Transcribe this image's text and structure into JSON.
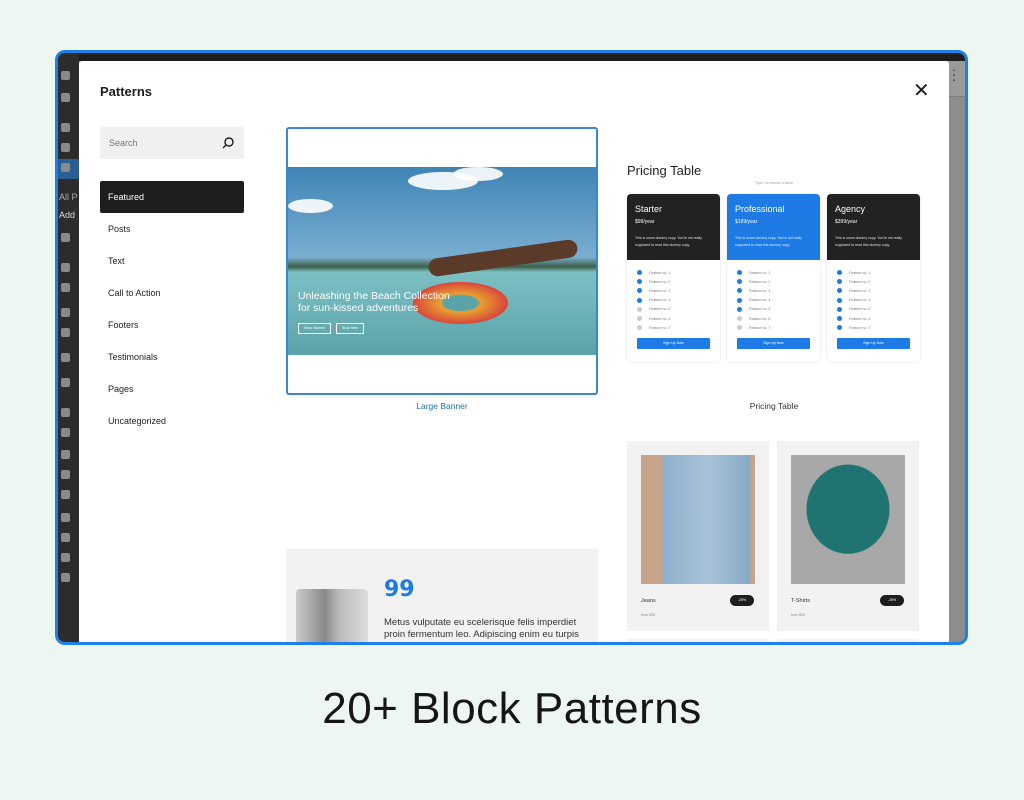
{
  "modal": {
    "title": "Patterns",
    "close_icon": "close-icon",
    "search_placeholder": "Search"
  },
  "admin_sidebar": {
    "partial_labels": [
      "All P",
      "Add"
    ]
  },
  "categories": [
    {
      "label": "Featured",
      "active": true
    },
    {
      "label": "Posts"
    },
    {
      "label": "Text"
    },
    {
      "label": "Call to Action"
    },
    {
      "label": "Footers"
    },
    {
      "label": "Testimonials"
    },
    {
      "label": "Pages"
    },
    {
      "label": "Uncategorized"
    }
  ],
  "patterns": {
    "large_banner": {
      "label": "Large Banner",
      "heading_line1": "Unleashing the Beach Collection",
      "heading_line2": "for sun-kissed adventures",
      "button1": "Shop Women",
      "button2": "Shop Men"
    },
    "pricing": {
      "label": "Pricing Table",
      "title": "Pricing Table",
      "hint": "Type / to choose a block",
      "signup": "Sign Up Now",
      "desc": "This is some dummy copy. You're not really supposed to read this dummy copy.",
      "plans": [
        {
          "name": "Starter",
          "price": "$99/year",
          "checked": 4,
          "highlight": false
        },
        {
          "name": "Professional",
          "price": "$199/year",
          "checked": 5,
          "highlight": true
        },
        {
          "name": "Agency",
          "price": "$399/year",
          "checked": 7,
          "highlight": false
        }
      ],
      "features": [
        "Feature no. 1",
        "Feature no. 2",
        "Feature no. 3",
        "Feature no. 4",
        "Feature no. 5",
        "Feature no. 6",
        "Feature no. 7"
      ]
    },
    "testimonial": {
      "quote_mark": "99",
      "text": "Metus vulputate eu scelerisque felis imperdiet proin fermentum leo. Adipiscing enim eu turpis egestas pretium aenean pharetra"
    },
    "products": [
      {
        "name": "Jeans",
        "from": "from $28",
        "badge": "-25%"
      },
      {
        "name": "T-Shirts",
        "from": "from $28",
        "badge": "-25%"
      }
    ]
  },
  "colors": {
    "accent": "#1e7be6",
    "frame": "#1e80e8",
    "page_bg": "#eef6f2"
  },
  "headline": "20+ Block Patterns"
}
